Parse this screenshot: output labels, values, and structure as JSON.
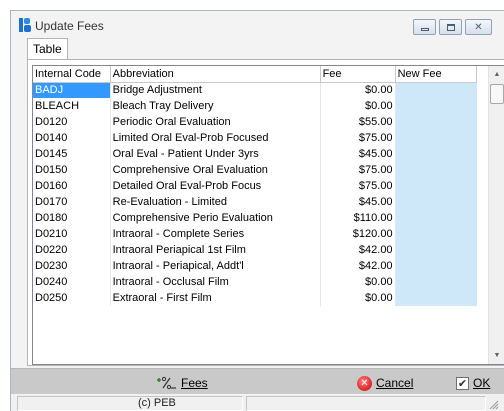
{
  "window": {
    "title": "Update Fees"
  },
  "icons": {
    "app": "app-icon",
    "minimize": "minimize-icon",
    "maximize": "maximize-icon",
    "close": "close-icon",
    "fees": "fees-icon",
    "cancel": "cancel-icon",
    "ok": "checkbox-icon",
    "grip": "resize-grip-icon"
  },
  "tabs": [
    {
      "label": "Table"
    }
  ],
  "table": {
    "columns": [
      "Internal Code",
      "Abbreviation",
      "Fee",
      "New Fee"
    ],
    "rows": [
      {
        "code": "BADJ",
        "abbr": "Bridge Adjustment",
        "fee": "$0.00",
        "new_fee": ""
      },
      {
        "code": "BLEACH",
        "abbr": "Bleach Tray Delivery",
        "fee": "$0.00",
        "new_fee": ""
      },
      {
        "code": "D0120",
        "abbr": "Periodic Oral Evaluation",
        "fee": "$55.00",
        "new_fee": ""
      },
      {
        "code": "D0140",
        "abbr": "Limited Oral Eval-Prob Focused",
        "fee": "$75.00",
        "new_fee": ""
      },
      {
        "code": "D0145",
        "abbr": "Oral Eval - Patient Under 3yrs",
        "fee": "$45.00",
        "new_fee": ""
      },
      {
        "code": "D0150",
        "abbr": "Comprehensive Oral Evaluation",
        "fee": "$75.00",
        "new_fee": ""
      },
      {
        "code": "D0160",
        "abbr": "Detailed Oral Eval-Prob Focus",
        "fee": "$75.00",
        "new_fee": ""
      },
      {
        "code": "D0170",
        "abbr": "Re-Evaluation - Limited",
        "fee": "$45.00",
        "new_fee": ""
      },
      {
        "code": "D0180",
        "abbr": "Comprehensive Perio Evaluation",
        "fee": "$110.00",
        "new_fee": ""
      },
      {
        "code": "D0210",
        "abbr": "Intraoral - Complete Series",
        "fee": "$120.00",
        "new_fee": ""
      },
      {
        "code": "D0220",
        "abbr": "Intraoral Periapical 1st Film",
        "fee": "$42.00",
        "new_fee": ""
      },
      {
        "code": "D0230",
        "abbr": "Intraoral - Periapical, Addt'l",
        "fee": "$42.00",
        "new_fee": ""
      },
      {
        "code": "D0240",
        "abbr": "Intraoral - Occlusal Film",
        "fee": "$0.00",
        "new_fee": ""
      },
      {
        "code": "D0250",
        "abbr": "Extraoral - First Film",
        "fee": "$0.00",
        "new_fee": ""
      }
    ]
  },
  "buttons": {
    "fees": "Fees",
    "cancel": "Cancel",
    "ok": "OK"
  },
  "status": {
    "copyright": "(c) PEB",
    "panel2": ""
  },
  "colors": {
    "selection": "#3399ff",
    "new_fee_cell": "#cfe8f9",
    "button_bar": "#c9c9c9"
  }
}
